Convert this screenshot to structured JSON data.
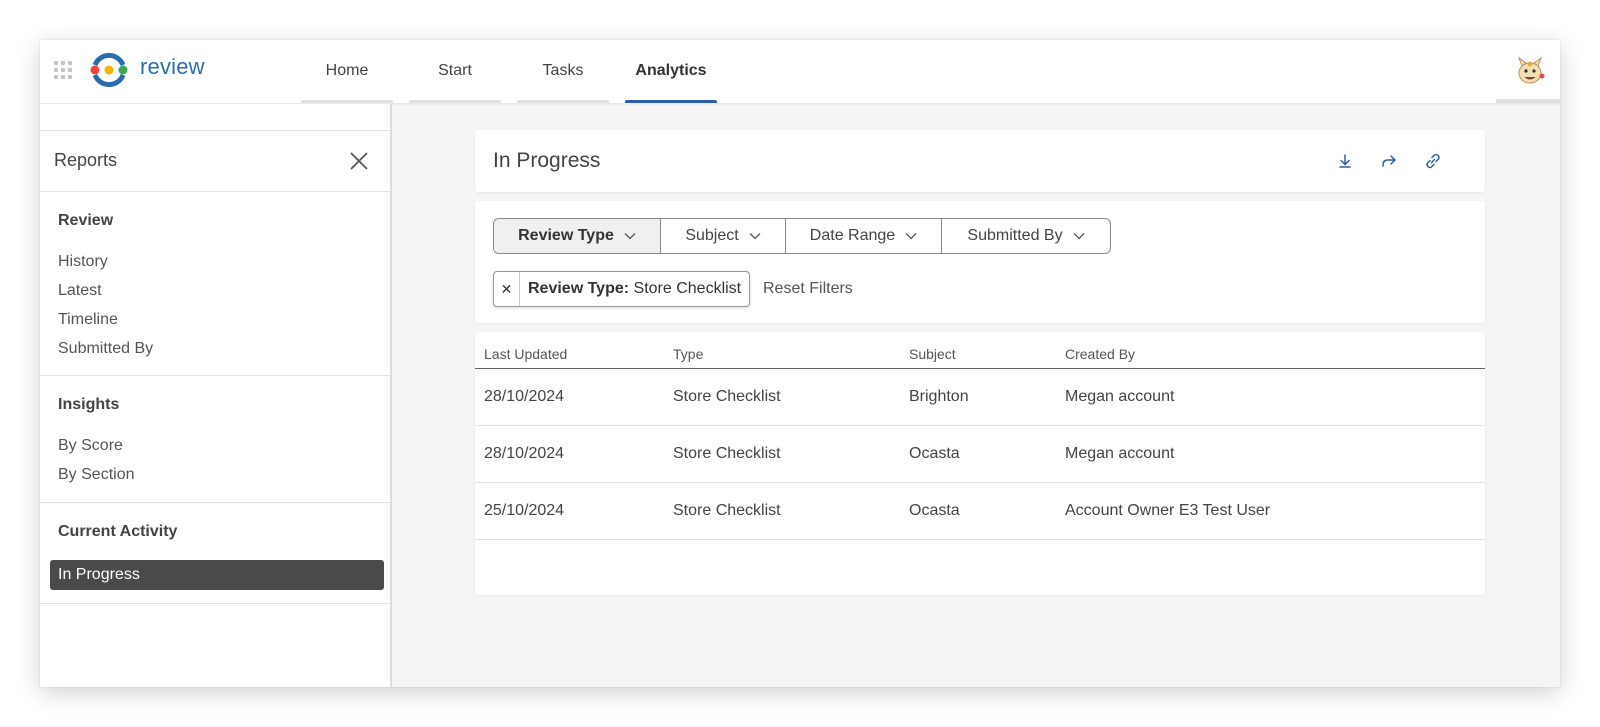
{
  "app": {
    "brand": "review"
  },
  "nav": {
    "items": [
      {
        "label": "Home"
      },
      {
        "label": "Start"
      },
      {
        "label": "Tasks"
      },
      {
        "label": "Analytics"
      }
    ],
    "active": "Analytics"
  },
  "sidebar": {
    "title": "Reports",
    "sections": [
      {
        "heading": "Review",
        "items": [
          "History",
          "Latest",
          "Timeline",
          "Submitted By"
        ]
      },
      {
        "heading": "Insights",
        "items": [
          "By Score",
          "By Section"
        ]
      },
      {
        "heading": "Current Activity",
        "items": [
          "In Progress"
        ]
      }
    ],
    "active_item": "In Progress"
  },
  "main": {
    "title": "In Progress",
    "filters": [
      "Review Type",
      "Subject",
      "Date Range",
      "Submitted By"
    ],
    "active_filter": "Review Type",
    "chip": {
      "key": "Review Type:",
      "value": "Store Checklist"
    },
    "reset_label": "Reset Filters",
    "table": {
      "columns": [
        "Last Updated",
        "Type",
        "Subject",
        "Created By"
      ],
      "rows": [
        [
          "28/10/2024",
          "Store Checklist",
          "Brighton",
          "Megan account"
        ],
        [
          "28/10/2024",
          "Store Checklist",
          "Ocasta",
          "Megan account"
        ],
        [
          "25/10/2024",
          "Store Checklist",
          "Ocasta",
          "Account Owner E3 Test User"
        ]
      ]
    }
  },
  "icons": {
    "apps": "apps-grid-icon",
    "close": "close-icon",
    "download": "download-icon",
    "share": "share-icon",
    "link": "link-icon",
    "chevron": "chevron-down-icon"
  },
  "colors": {
    "accent": "#2f5ea8",
    "brand": "#2a6cb0",
    "active_item_bg": "#4a4a4a"
  }
}
